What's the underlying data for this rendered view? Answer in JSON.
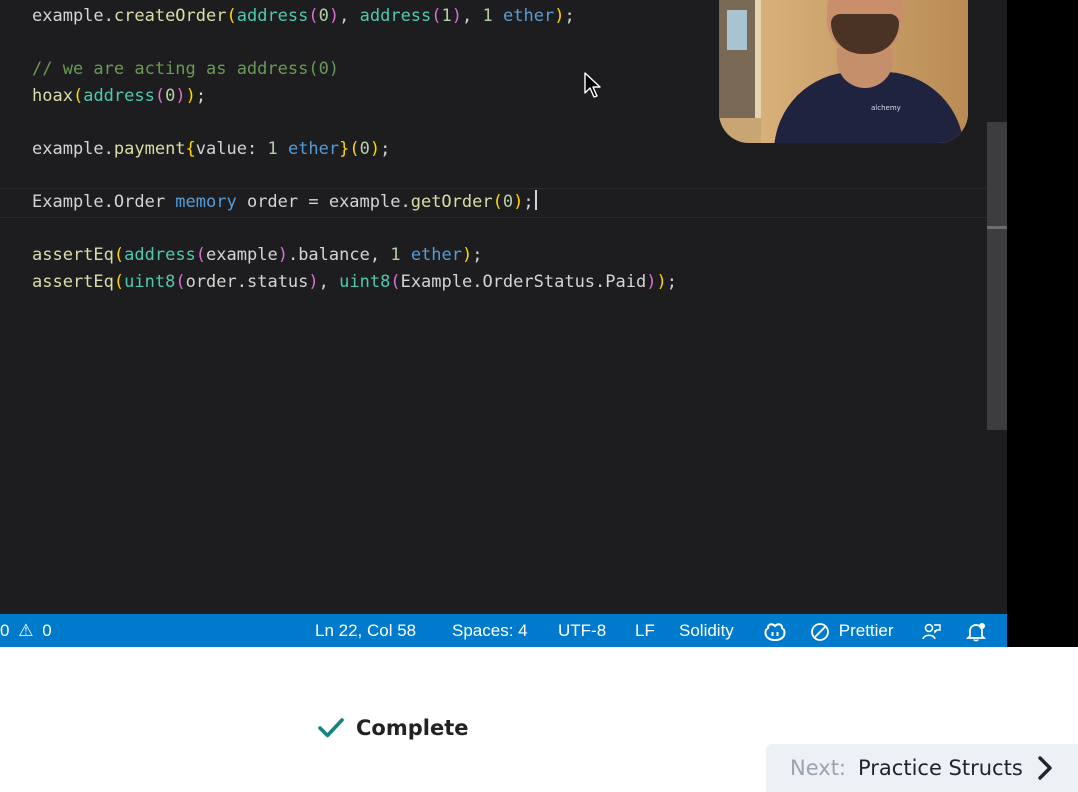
{
  "editor": {
    "lines": [
      {
        "tokens": [
          [
            "txt",
            "example."
          ],
          [
            "fn",
            "createOrder"
          ],
          [
            "p1",
            "("
          ],
          [
            "ty",
            "address"
          ],
          [
            "p2",
            "("
          ],
          [
            "num",
            "0"
          ],
          [
            "p2",
            ")"
          ],
          [
            "txt",
            ", "
          ],
          [
            "ty",
            "address"
          ],
          [
            "p2",
            "("
          ],
          [
            "num",
            "1"
          ],
          [
            "p2",
            ")"
          ],
          [
            "txt",
            ", "
          ],
          [
            "num",
            "1"
          ],
          [
            "txt",
            " "
          ],
          [
            "kw",
            "ether"
          ],
          [
            "p1",
            ")"
          ],
          [
            "txt",
            ";"
          ]
        ]
      },
      {
        "tokens": []
      },
      {
        "tokens": [
          [
            "cmt",
            "// we are acting as address(0)"
          ]
        ]
      },
      {
        "tokens": [
          [
            "fn",
            "hoax"
          ],
          [
            "p1",
            "("
          ],
          [
            "ty",
            "address"
          ],
          [
            "p2",
            "("
          ],
          [
            "num",
            "0"
          ],
          [
            "p2",
            ")"
          ],
          [
            "p1",
            ")"
          ],
          [
            "txt",
            ";"
          ]
        ]
      },
      {
        "tokens": []
      },
      {
        "tokens": [
          [
            "txt",
            "example."
          ],
          [
            "fn",
            "payment"
          ],
          [
            "p1",
            "{"
          ],
          [
            "txt",
            "value: "
          ],
          [
            "num",
            "1"
          ],
          [
            "txt",
            " "
          ],
          [
            "kw",
            "ether"
          ],
          [
            "p1",
            "}"
          ],
          [
            "p1",
            "("
          ],
          [
            "num",
            "0"
          ],
          [
            "p1",
            ")"
          ],
          [
            "txt",
            ";"
          ]
        ]
      },
      {
        "tokens": []
      },
      {
        "tokens": [
          [
            "txt",
            "Example.Order "
          ],
          [
            "kw",
            "memory"
          ],
          [
            "txt",
            " order = example."
          ],
          [
            "fn",
            "getOrder"
          ],
          [
            "p1",
            "("
          ],
          [
            "num",
            "0"
          ],
          [
            "p1",
            ")"
          ],
          [
            "txt",
            ";"
          ]
        ],
        "caret": true
      },
      {
        "tokens": []
      },
      {
        "tokens": [
          [
            "fn",
            "assertEq"
          ],
          [
            "p1",
            "("
          ],
          [
            "ty",
            "address"
          ],
          [
            "p2",
            "("
          ],
          [
            "txt",
            "example"
          ],
          [
            "p2",
            ")"
          ],
          [
            "txt",
            ".balance, "
          ],
          [
            "num",
            "1"
          ],
          [
            "txt",
            " "
          ],
          [
            "kw",
            "ether"
          ],
          [
            "p1",
            ")"
          ],
          [
            "txt",
            ";"
          ]
        ]
      },
      {
        "tokens": [
          [
            "fn",
            "assertEq"
          ],
          [
            "p1",
            "("
          ],
          [
            "ty",
            "uint8"
          ],
          [
            "p2",
            "("
          ],
          [
            "txt",
            "order.status"
          ],
          [
            "p2",
            ")"
          ],
          [
            "txt",
            ", "
          ],
          [
            "ty",
            "uint8"
          ],
          [
            "p2",
            "("
          ],
          [
            "txt",
            "Example.OrderStatus.Paid"
          ],
          [
            "p2",
            ")"
          ],
          [
            "p1",
            ")"
          ],
          [
            "txt",
            ";"
          ]
        ]
      }
    ]
  },
  "webcam": {
    "shirt_logo": "alchemy"
  },
  "statusbar": {
    "problems": "0",
    "warnings_icon": "⚠",
    "warnings": "0",
    "position": "Ln 22, Col 58",
    "spaces": "Spaces: 4",
    "encoding": "UTF-8",
    "eol": "LF",
    "language": "Solidity",
    "prettier": "Prettier",
    "copilot_icon": "copilot-icon",
    "prettier_icon": "prohibited-icon",
    "feedback_icon": "feedback-icon",
    "bell_icon": "bell-icon"
  },
  "lesson": {
    "complete_label": "Complete",
    "next_prefix": "Next:",
    "next_title": "Practice Structs"
  },
  "colors": {
    "editor_bg": "#1d1d1f",
    "statusbar_bg": "#007acc",
    "check": "#15837f",
    "next_bg": "#edf0f4"
  }
}
